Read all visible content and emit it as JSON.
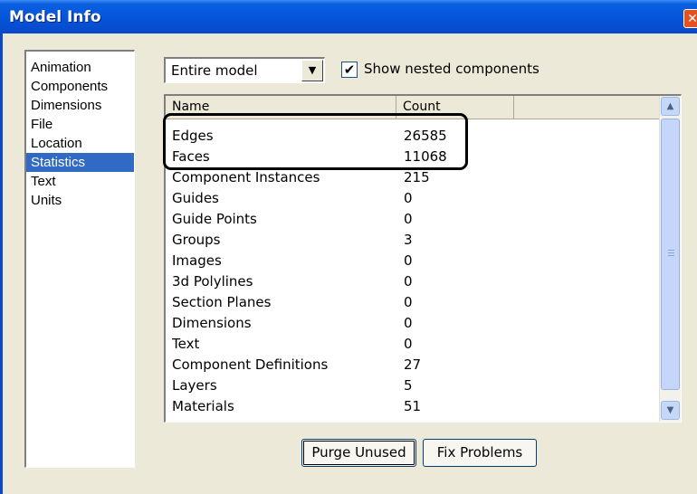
{
  "window": {
    "title": "Model Info",
    "close_glyph": "✕"
  },
  "categories": [
    {
      "label": "Animation"
    },
    {
      "label": "Components"
    },
    {
      "label": "Dimensions"
    },
    {
      "label": "File"
    },
    {
      "label": "Location"
    },
    {
      "label": "Statistics",
      "selected": true
    },
    {
      "label": "Text"
    },
    {
      "label": "Units"
    }
  ],
  "scope_select": {
    "value": "Entire model",
    "arrow": "▼"
  },
  "nested_checkbox": {
    "label": "Show nested components",
    "checked": true,
    "mark": "✔"
  },
  "stats_table": {
    "headers": {
      "name": "Name",
      "count": "Count"
    },
    "rows": [
      {
        "name": "Edges",
        "count": "26585"
      },
      {
        "name": "Faces",
        "count": "11068"
      },
      {
        "name": "Component Instances",
        "count": "215"
      },
      {
        "name": "Guides",
        "count": "0"
      },
      {
        "name": "Guide Points",
        "count": "0"
      },
      {
        "name": "Groups",
        "count": "3"
      },
      {
        "name": "Images",
        "count": "0"
      },
      {
        "name": "3d Polylines",
        "count": "0"
      },
      {
        "name": "Section Planes",
        "count": "0"
      },
      {
        "name": "Dimensions",
        "count": "0"
      },
      {
        "name": "Text",
        "count": "0"
      },
      {
        "name": "Component Definitions",
        "count": "27"
      },
      {
        "name": "Layers",
        "count": "5"
      },
      {
        "name": "Materials",
        "count": "51"
      }
    ]
  },
  "scrollbar": {
    "up": "▲",
    "down": "▼"
  },
  "buttons": {
    "purge": "Purge Unused",
    "fix": "Fix Problems"
  },
  "colors": {
    "selection": "#316ac5",
    "titlebar": "#0553d9",
    "highlight_box": "#000000"
  }
}
